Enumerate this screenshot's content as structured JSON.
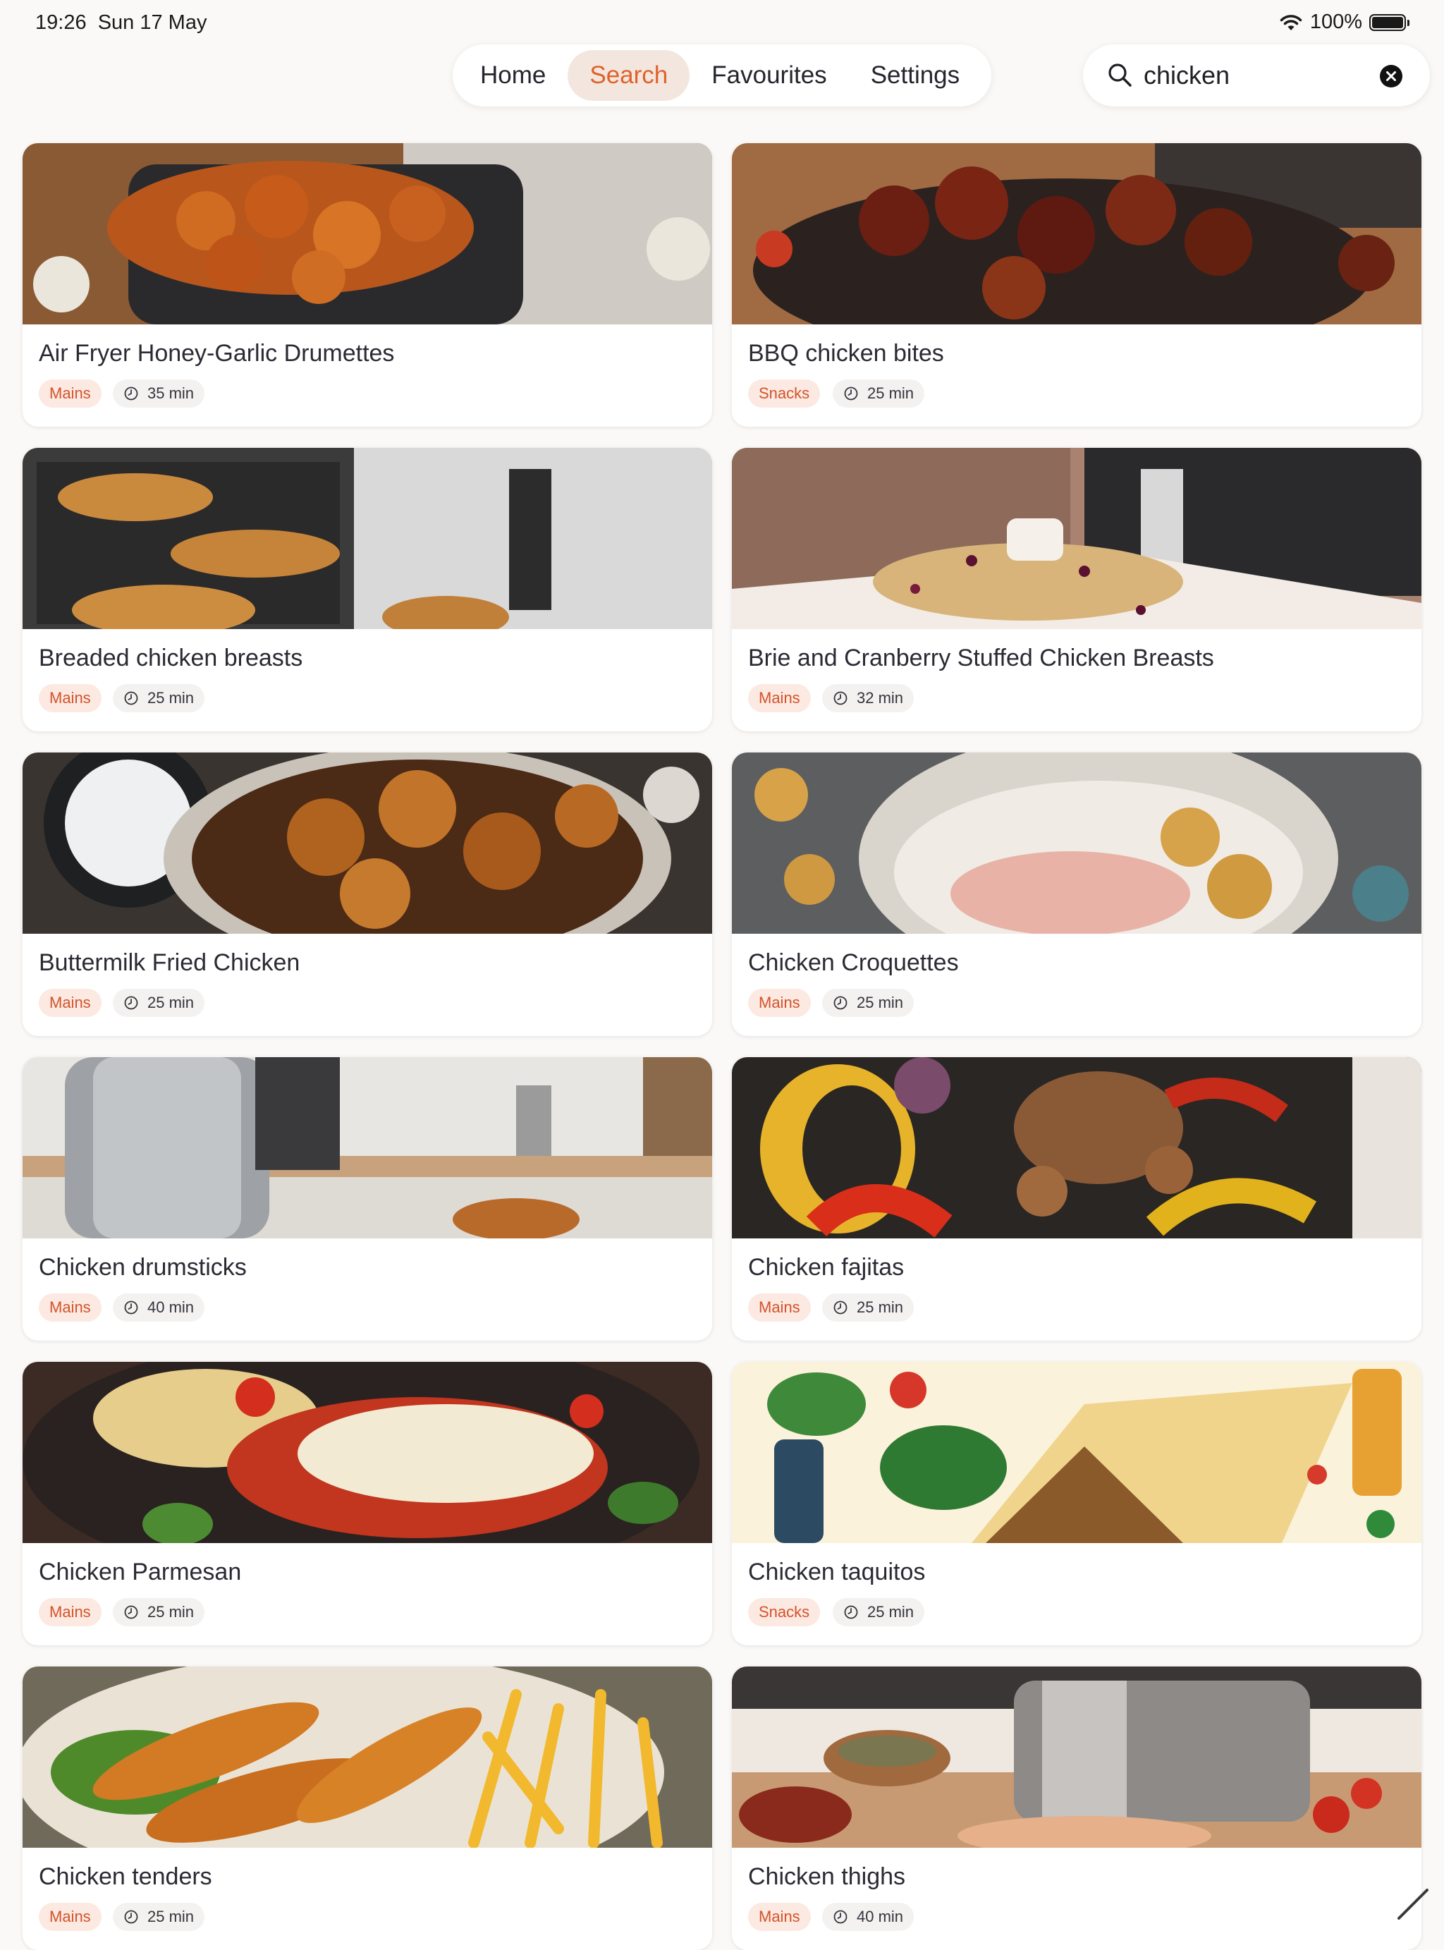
{
  "status": {
    "time": "19:26",
    "date": "Sun 17 May",
    "battery_text": "100%"
  },
  "nav": {
    "tabs": [
      {
        "label": "Home",
        "active": false
      },
      {
        "label": "Search",
        "active": true
      },
      {
        "label": "Favourites",
        "active": false
      },
      {
        "label": "Settings",
        "active": false
      }
    ]
  },
  "search": {
    "value": "chicken",
    "placeholder": ""
  },
  "colors": {
    "accent": "#e0622a",
    "category_chip_bg": "#fbe9e2",
    "category_chip_text": "#d4532a",
    "background": "#fbf9f7"
  },
  "recipes": [
    {
      "title": "Air Fryer Honey-Garlic Drumettes",
      "category": "Mains",
      "time": "35 min",
      "photo": "honey-garlic-drumettes-in-air-fryer"
    },
    {
      "title": "BBQ chicken bites",
      "category": "Snacks",
      "time": "25 min",
      "photo": "glazed-bbq-chicken-bites"
    },
    {
      "title": "Breaded chicken breasts",
      "category": "Mains",
      "time": "25 min",
      "photo": "breaded-chicken-in-air-fryer-basket"
    },
    {
      "title": "Brie and Cranberry Stuffed Chicken Breasts",
      "category": "Mains",
      "time": "32 min",
      "photo": "brie-cranberry-stuffed-chicken"
    },
    {
      "title": "Buttermilk Fried Chicken",
      "category": "Mains",
      "time": "25 min",
      "photo": "buttermilk-fried-chicken"
    },
    {
      "title": "Chicken Croquettes",
      "category": "Mains",
      "time": "25 min",
      "photo": "chicken-croquettes-bowl"
    },
    {
      "title": "Chicken drumsticks",
      "category": "Mains",
      "time": "40 min",
      "photo": "air-fryer-in-kitchen-with-drumstick"
    },
    {
      "title": "Chicken fajitas",
      "category": "Mains",
      "time": "25 min",
      "photo": "chicken-fajitas-with-peppers"
    },
    {
      "title": "Chicken Parmesan",
      "category": "Mains",
      "time": "25 min",
      "photo": "chicken-parmesan-with-spaghetti"
    },
    {
      "title": "Chicken taquitos",
      "category": "Snacks",
      "time": "25 min",
      "photo": "chicken-taquito-illustration"
    },
    {
      "title": "Chicken tenders",
      "category": "Mains",
      "time": "25 min",
      "photo": "chicken-tenders-with-fries"
    },
    {
      "title": "Chicken thighs",
      "category": "Mains",
      "time": "40 min",
      "photo": "seasoned-chicken-thighs-and-spices"
    }
  ]
}
